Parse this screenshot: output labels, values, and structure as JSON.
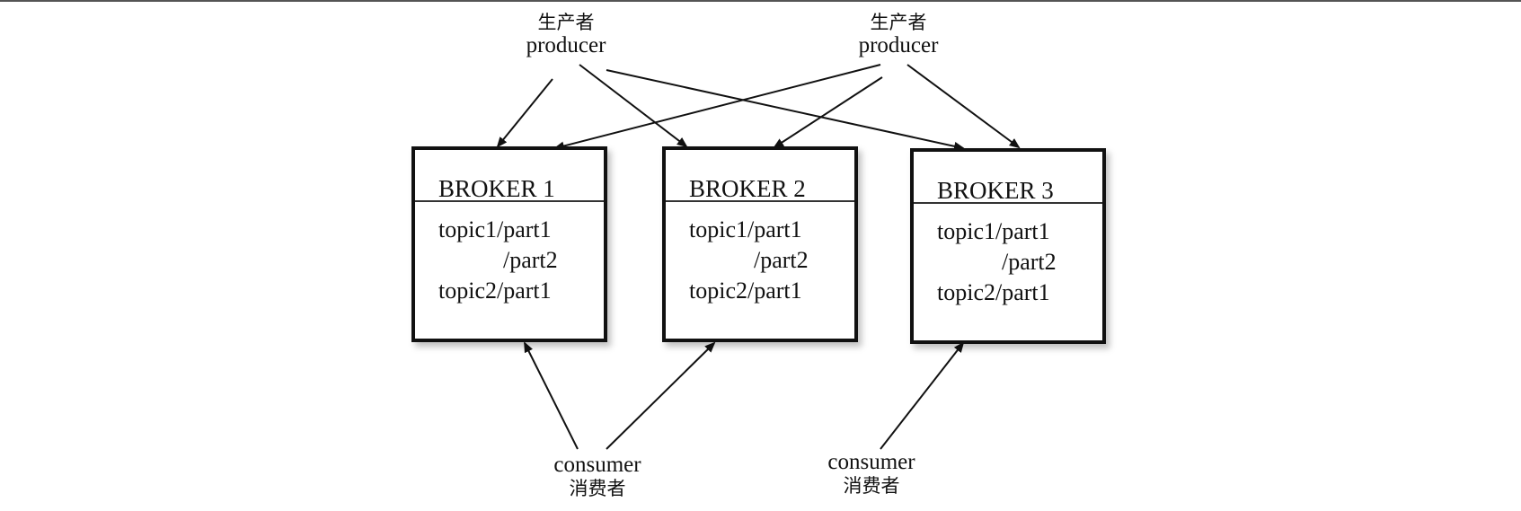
{
  "producers": [
    {
      "zh": "生产者",
      "en": "producer"
    },
    {
      "zh": "生产者",
      "en": "producer"
    }
  ],
  "brokers": [
    {
      "title": "BROKER 1",
      "lines": [
        "topic1/part1",
        "/part2",
        "topic2/part1"
      ]
    },
    {
      "title": "BROKER 2",
      "lines": [
        "topic1/part1",
        "/part2",
        "topic2/part1"
      ]
    },
    {
      "title": "BROKER 3",
      "lines": [
        "topic1/part1",
        "/part2",
        "topic2/part1"
      ]
    }
  ],
  "consumers": [
    {
      "en": "consumer",
      "zh": "消费者"
    },
    {
      "en": "consumer",
      "zh": "消费者"
    }
  ]
}
